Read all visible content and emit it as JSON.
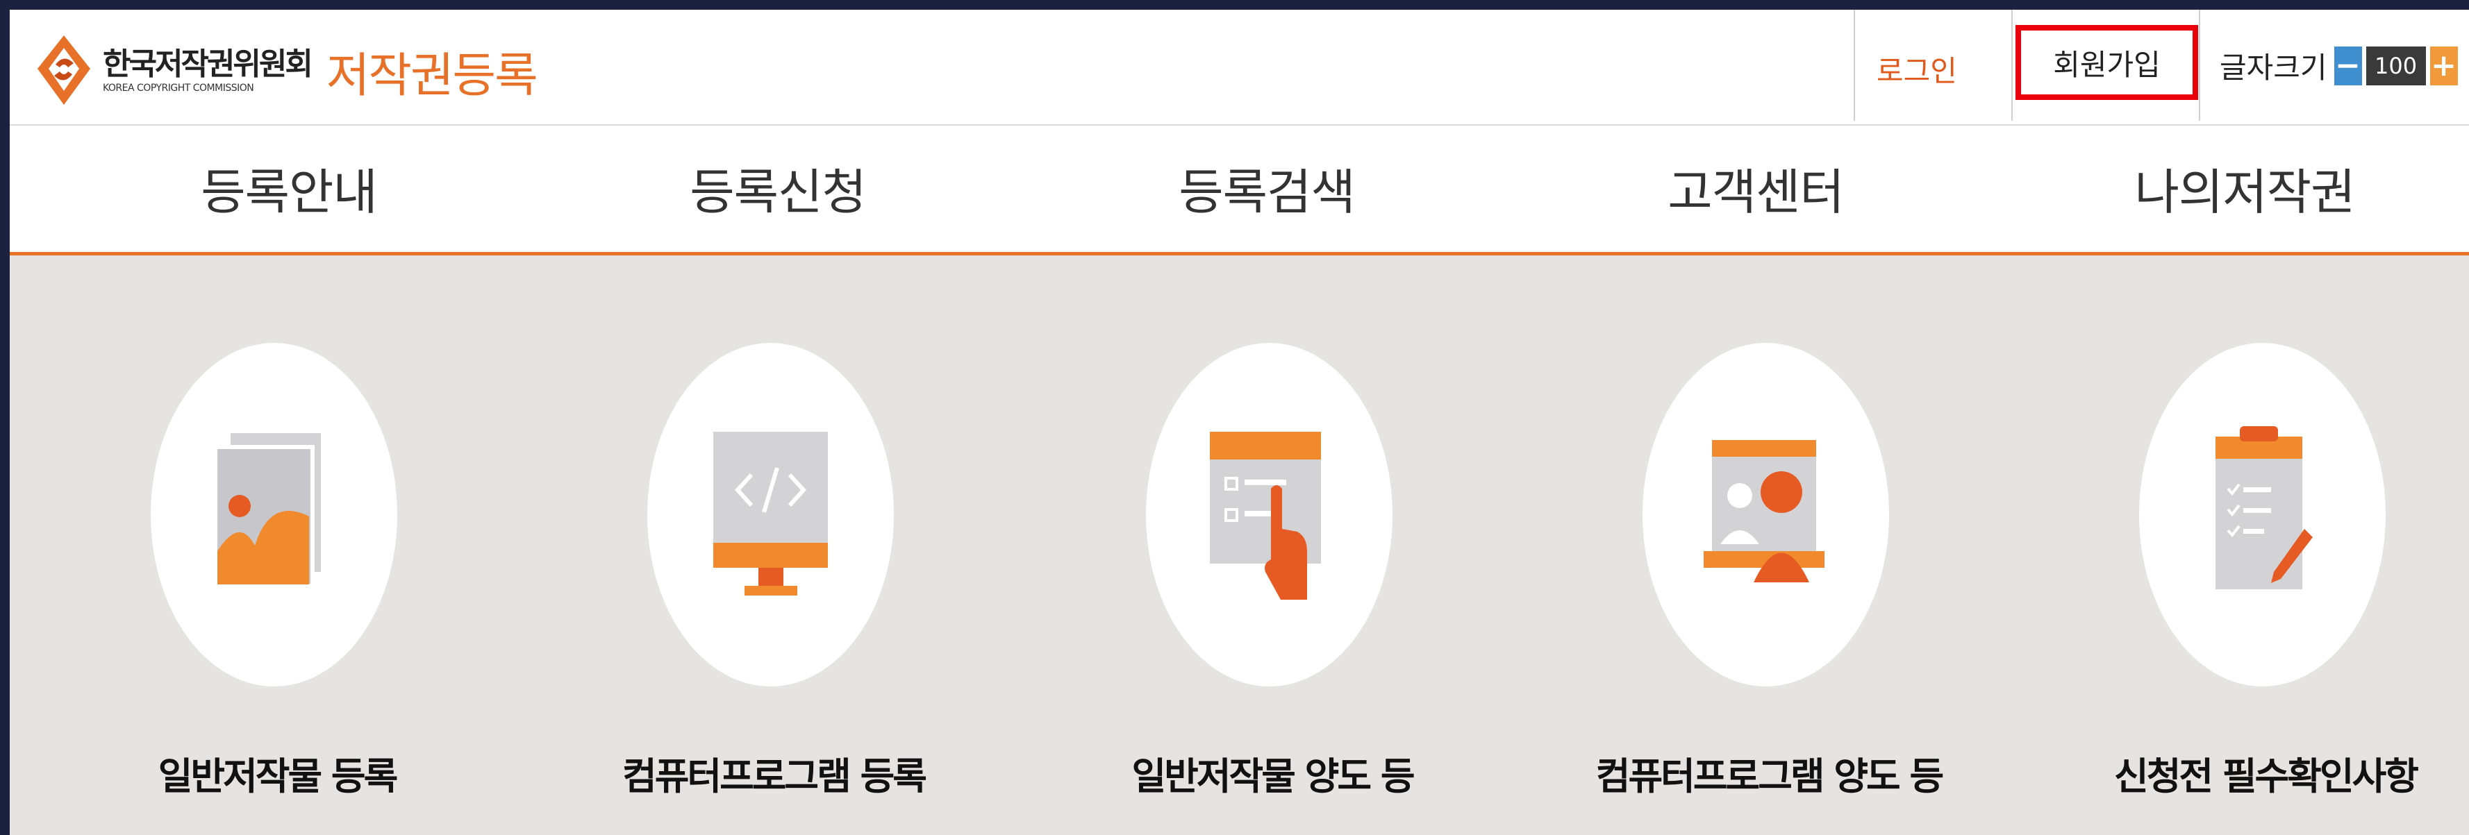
{
  "header": {
    "org_name": "한국저작권위원회",
    "org_subtitle": "KOREA COPYRIGHT COMMISSION",
    "service_name": "저작권등록",
    "login_label": "로그인",
    "signup_label": "회원가입",
    "font_size_label": "글자크기",
    "font_size_value": "100",
    "minus_symbol": "−",
    "plus_symbol": "+"
  },
  "nav": {
    "items": [
      "등록안내",
      "등록신청",
      "등록검색",
      "고객센터",
      "나의저작권"
    ]
  },
  "cards": [
    {
      "label": "일반저작물 등록",
      "icon": "image-icon"
    },
    {
      "label": "컴퓨터프로그램 등록",
      "icon": "code-monitor-icon"
    },
    {
      "label": "일반저작물 양도 등",
      "icon": "document-hand-icon"
    },
    {
      "label": "컴퓨터프로그램 양도 등",
      "icon": "person-screen-icon"
    },
    {
      "label": "신청전 필수확인사항",
      "icon": "clipboard-checklist-icon"
    }
  ],
  "colors": {
    "accent": "#e8712a",
    "highlight_border": "#e8000b",
    "background": "#e6e3e3",
    "minus_button": "#3f8ecf",
    "plus_button": "#f19a3c"
  }
}
